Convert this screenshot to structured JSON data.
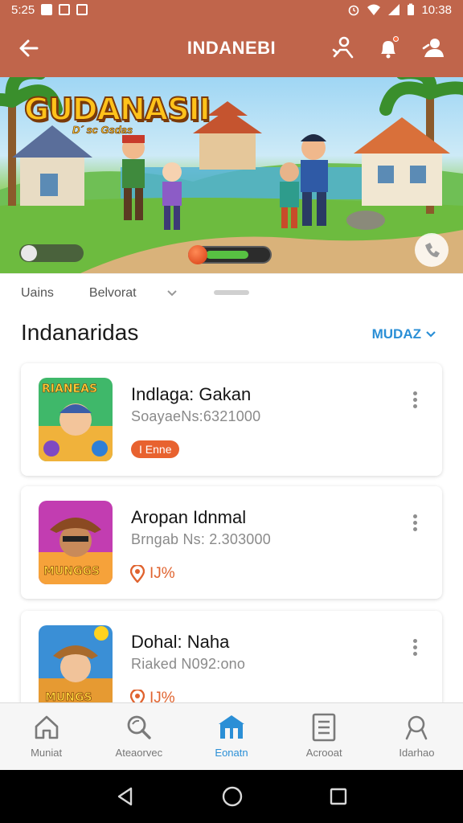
{
  "status_bar": {
    "time": "5:25",
    "clock": "10:38"
  },
  "app_bar": {
    "title": "INDANEBI"
  },
  "banner": {
    "title": "GUDANASII",
    "subtitle": "D´ sc Gsdas",
    "progress_fraction": 0.7
  },
  "filters": {
    "item1": "Uains",
    "item2": "Belvorat"
  },
  "section": {
    "title": "Indanaridas",
    "link": "MUDAZ"
  },
  "cards": [
    {
      "name": "Indlaga: Gakan",
      "meta": "SoayaeNs:6321000",
      "tag": "I Enne",
      "thumb_text": "RIANEAS"
    },
    {
      "name": "Aropan Idnmal",
      "meta": "Brngab Ns: 2.303000",
      "rating": "IJ%",
      "thumb_text": "MUNGGS"
    },
    {
      "name": "Dohal: Naha",
      "meta": "Riaked N092:ono",
      "rating": "IJ%",
      "thumb_text": "MUNGS"
    }
  ],
  "bottom_nav": [
    {
      "label": "Muniat",
      "icon": "home-icon",
      "active": false
    },
    {
      "label": "Ateaorvec",
      "icon": "search-icon",
      "active": false
    },
    {
      "label": "Eonatn",
      "icon": "store-icon",
      "active": true
    },
    {
      "label": "Acrooat",
      "icon": "document-icon",
      "active": false
    },
    {
      "label": "Idarhao",
      "icon": "profile-icon",
      "active": false
    }
  ],
  "colors": {
    "primary": "#c0654b",
    "accent": "#2b8fd6",
    "tag": "#e8622f"
  }
}
